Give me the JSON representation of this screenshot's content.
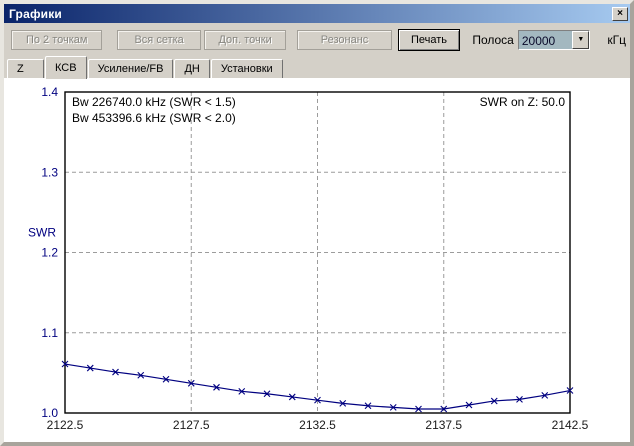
{
  "window": {
    "title": "Графики"
  },
  "icons": {
    "close": "×",
    "dropdown": "▼"
  },
  "toolbar": {
    "disabled_buttons": [
      "По 2 точкам",
      "Вся сетка",
      "Доп. точки",
      "Резонанс"
    ],
    "print_button": "Печать",
    "band_label": "Полоса",
    "band_value": "20000",
    "band_unit": "кГц"
  },
  "tabs": [
    {
      "label": "Z",
      "active": false
    },
    {
      "label": "КСВ",
      "active": true
    },
    {
      "label": "Усиление/FB",
      "active": false
    },
    {
      "label": "ДН",
      "active": false
    },
    {
      "label": "Установки",
      "active": false
    }
  ],
  "chart_data": {
    "type": "line",
    "title": "",
    "xlabel": "",
    "ylabel": "SWR",
    "series": [
      {
        "name": "SWR",
        "x": [
          2122.5,
          2123.5,
          2124.5,
          2125.5,
          2126.5,
          2127.5,
          2128.5,
          2129.5,
          2130.5,
          2131.5,
          2132.5,
          2133.5,
          2134.5,
          2135.5,
          2136.5,
          2137.5,
          2138.5,
          2139.5,
          2140.5,
          2141.5,
          2142.5
        ],
        "values": [
          1.061,
          1.056,
          1.051,
          1.047,
          1.042,
          1.037,
          1.032,
          1.027,
          1.024,
          1.02,
          1.016,
          1.012,
          1.009,
          1.007,
          1.005,
          1.005,
          1.01,
          1.015,
          1.017,
          1.022,
          1.028
        ]
      }
    ],
    "xlim": [
      2122.5,
      2142.5
    ],
    "ylim": [
      1.0,
      1.4
    ],
    "xticks": [
      "2122.5",
      "2127.5",
      "2132.5",
      "2137.5",
      "2142.5"
    ],
    "yticks": [
      "1.0",
      "1.1",
      "1.2",
      "1.3",
      "1.4"
    ],
    "grid_x": [
      2127.5,
      2132.5,
      2137.5
    ],
    "grid_y": [
      1.1,
      1.2,
      1.3
    ],
    "grid_style": "dashed",
    "legend": "none",
    "marker": "x",
    "line_color": "#000080",
    "annotations": {
      "bw_lines": [
        "Bw 226740.0 kHz (SWR < 1.5)",
        "Bw 453396.6 kHz (SWR < 2.0)"
      ],
      "top_right": "SWR on Z: 50.0"
    }
  },
  "colors": {
    "accent_navy": "#000080",
    "titlebar_gradient_left": "#0a246a",
    "titlebar_gradient_right": "#a6caf0",
    "window_chrome": "#d4d0c8",
    "combo_selection_bg": "#a3b8c0",
    "grid_gray": "#9c9c9c",
    "tick_label": "#1a1a1a"
  }
}
